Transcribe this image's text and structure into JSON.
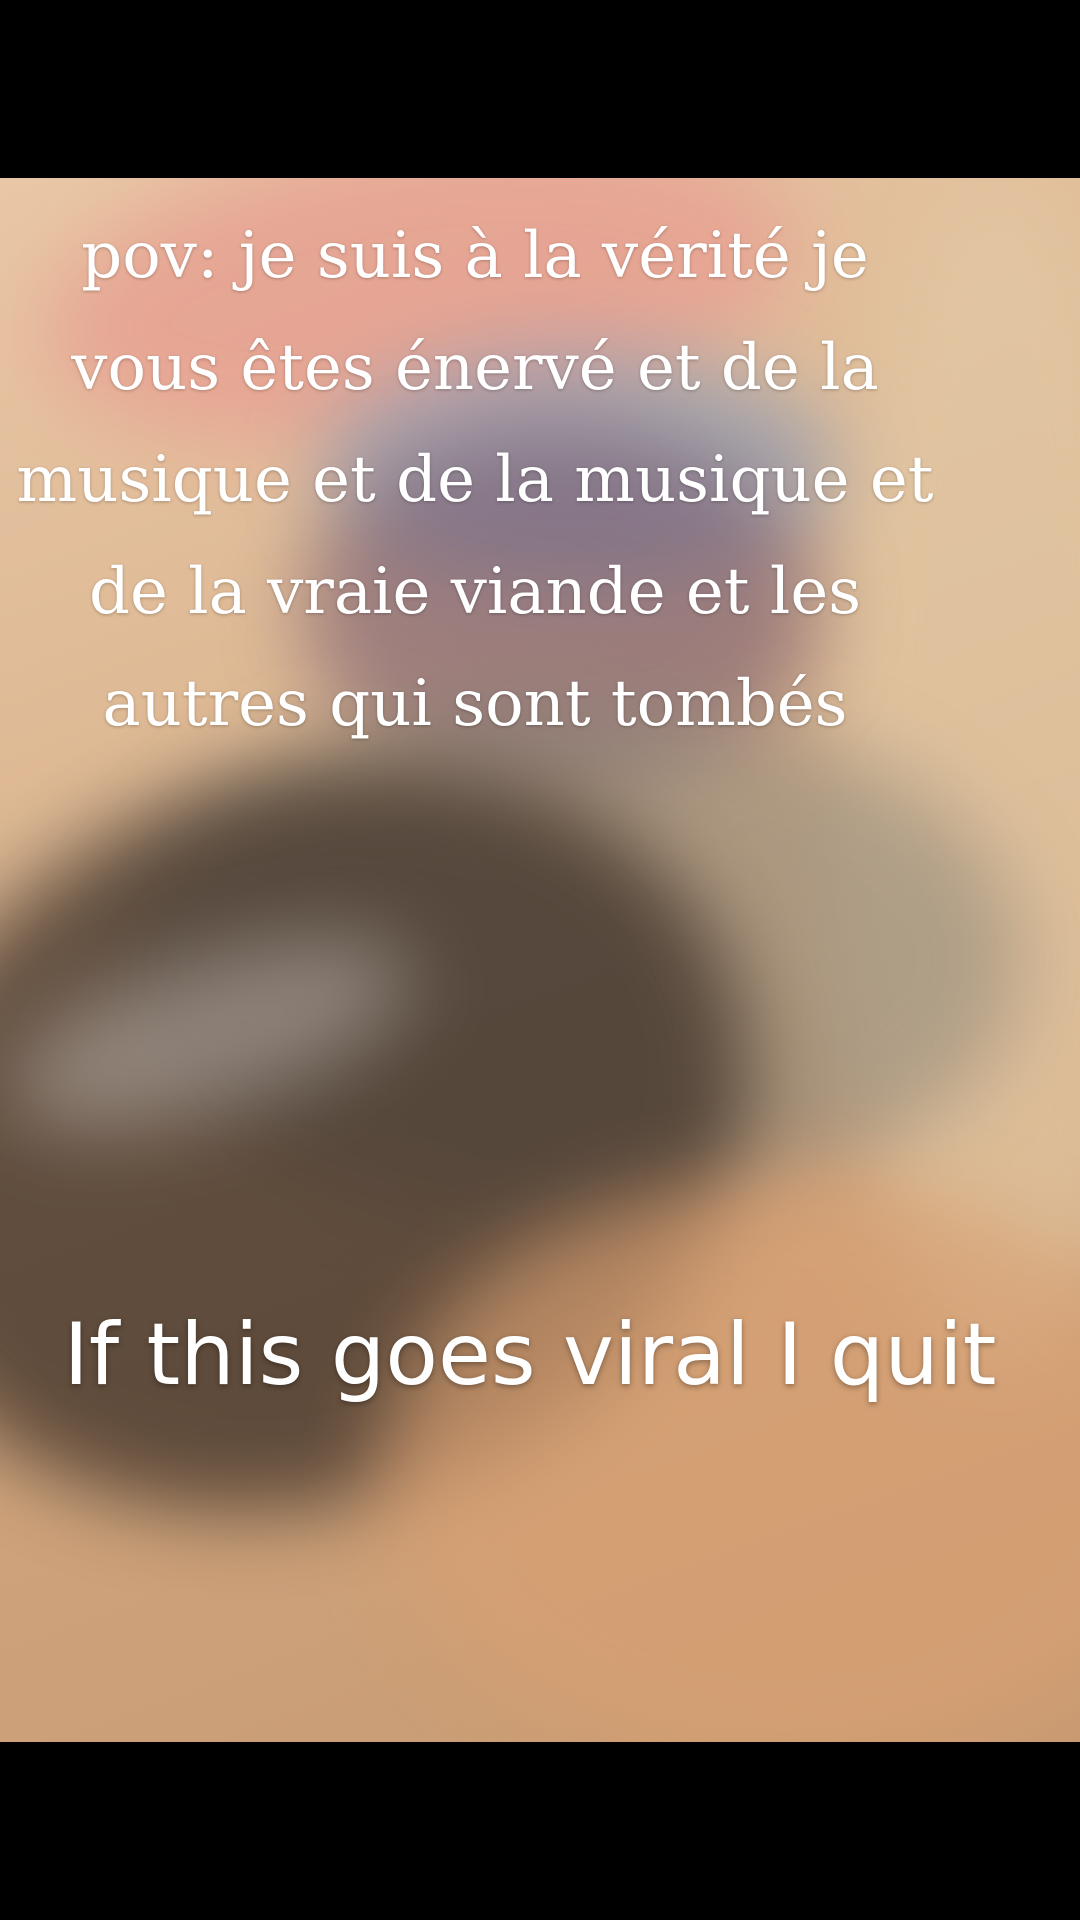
{
  "overlay": {
    "top_text": "pov: je suis à la vérité je vous êtes énervé et de la musique et de la musique et de la vraie viande et les autres qui sont tombés",
    "bottom_text": "If this goes viral I quit"
  },
  "colors": {
    "letterbox": "#000000",
    "caption_text": "#ffffff"
  }
}
